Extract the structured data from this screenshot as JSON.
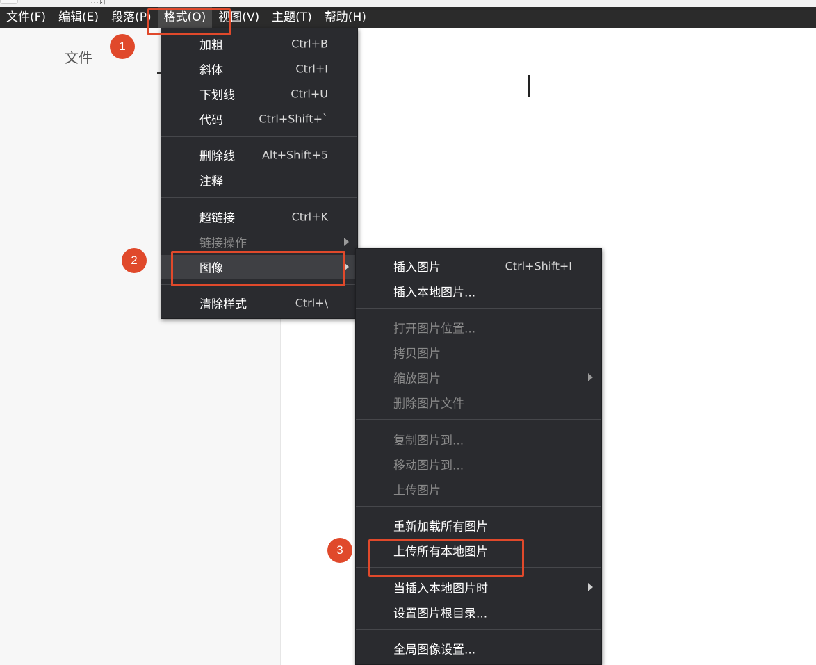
{
  "titlebar": {
    "text": "…计"
  },
  "menubar": {
    "items": [
      {
        "label": "文件(F)"
      },
      {
        "label": "编辑(E)"
      },
      {
        "label": "段落(P)"
      },
      {
        "label": "格式(O)"
      },
      {
        "label": "视图(V)"
      },
      {
        "label": "主题(T)"
      },
      {
        "label": "帮助(H)"
      }
    ]
  },
  "sidebar": {
    "title": "文件"
  },
  "format_menu": {
    "items": [
      {
        "label": "加粗",
        "shortcut": "Ctrl+B"
      },
      {
        "label": "斜体",
        "shortcut": "Ctrl+I"
      },
      {
        "label": "下划线",
        "shortcut": "Ctrl+U"
      },
      {
        "label": "代码",
        "shortcut": "Ctrl+Shift+`"
      },
      {
        "label": "删除线",
        "shortcut": "Alt+Shift+5"
      },
      {
        "label": "注释",
        "shortcut": ""
      },
      {
        "label": "超链接",
        "shortcut": "Ctrl+K"
      },
      {
        "label": "链接操作",
        "shortcut": ""
      },
      {
        "label": "图像",
        "shortcut": ""
      },
      {
        "label": "清除样式",
        "shortcut": "Ctrl+\\"
      }
    ]
  },
  "image_menu": {
    "items": [
      {
        "label": "插入图片",
        "shortcut": "Ctrl+Shift+I"
      },
      {
        "label": "插入本地图片..."
      },
      {
        "label": "打开图片位置..."
      },
      {
        "label": "拷贝图片"
      },
      {
        "label": "缩放图片"
      },
      {
        "label": "删除图片文件"
      },
      {
        "label": "复制图片到..."
      },
      {
        "label": "移动图片到..."
      },
      {
        "label": "上传图片"
      },
      {
        "label": "重新加载所有图片"
      },
      {
        "label": "上传所有本地图片"
      },
      {
        "label": "当插入本地图片时"
      },
      {
        "label": "设置图片根目录..."
      },
      {
        "label": "全局图像设置..."
      }
    ]
  },
  "annotations": {
    "step1": "1",
    "step2": "2",
    "step3": "3"
  },
  "colors": {
    "menubar_bg": "#2b2b2b",
    "menu_bg": "#2a2b2f",
    "highlight": "#e0492b"
  }
}
